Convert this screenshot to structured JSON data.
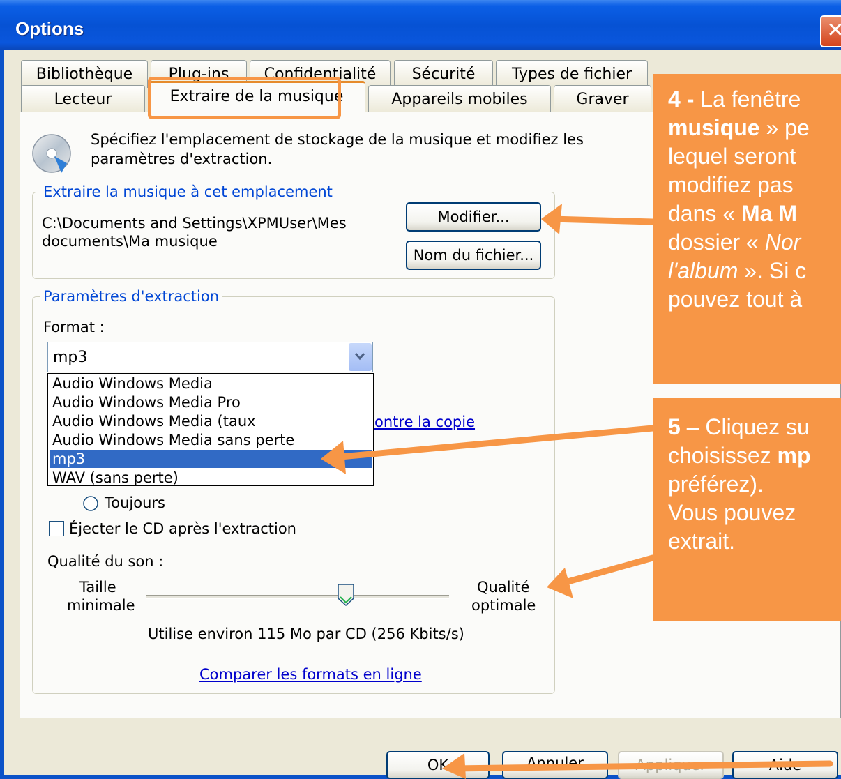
{
  "window": {
    "title": "Options",
    "close_glyph": "✕"
  },
  "tabs": {
    "row1": [
      "Bibliothèque",
      "Plug-ins",
      "Confidentialité",
      "Sécurité",
      "Types de fichier"
    ],
    "row2": [
      "Lecteur",
      "Extraire de la musique",
      "Appareils mobiles",
      "Graver"
    ]
  },
  "header_text": {
    "line1": "Spécifiez l'emplacement de stockage de la musique et modifiez les",
    "line2": "paramètres d'extraction."
  },
  "location_group": {
    "label": "Extraire la musique à cet emplacement",
    "path_line1": "C:\\Documents and Settings\\XPMUser\\Mes",
    "path_line2": "documents\\Ma musique",
    "modify_button": "Modifier...",
    "filename_button": "Nom du fichier..."
  },
  "settings_group": {
    "label": "Paramètres d'extraction",
    "format_label": "Format :",
    "format_value": "mp3",
    "format_options": [
      "Audio Windows Media",
      "Audio Windows Media Pro",
      "Audio Windows Media (taux d'échantillonnage",
      "Audio Windows Media sans perte",
      "mp3",
      "WAV (sans perte)"
    ],
    "selected_index": 4,
    "copy_protect_link_fragment": "ontre la copie",
    "always_radio": "Toujours",
    "eject_checkbox": "Éjecter le CD après l'extraction",
    "quality_label": "Qualité du son :",
    "min_label_1": "Taille",
    "min_label_2": "minimale",
    "max_label_1": "Qualité",
    "max_label_2": "optimale",
    "quality_level": 0.66,
    "usage_text": "Utilise environ 115 Mo par CD (256 Kbits/s)",
    "compare_link": "Comparer les formats en ligne"
  },
  "buttons": {
    "ok": "OK",
    "cancel": "Annuler",
    "apply": "Appliquer",
    "help": "Aide"
  },
  "annotations": {
    "box4": {
      "num": "4 - ",
      "l1": "La fenêtre",
      "l2b": "musique",
      "l2": " » pe",
      "l3": "lequel seront",
      "l4": "modifiez pas",
      "l5a": "dans « ",
      "l5b": "Ma M",
      "l6a": "dossier « ",
      "l6b": "Nor",
      "l7a": "l'album",
      "l7b": " ». Si c",
      "l8": "pouvez tout à"
    },
    "box5": {
      "num": "5",
      "l1": " – Cliquez su",
      "l2a": "choisissez ",
      "l2b": "mp",
      "l3": "préférez).",
      "l4": "Vous pouvez",
      "l5": "extrait."
    }
  },
  "colors": {
    "accent_orange": "#f79646",
    "title_blue": "#0a56dc",
    "link_blue": "#0000cc"
  }
}
